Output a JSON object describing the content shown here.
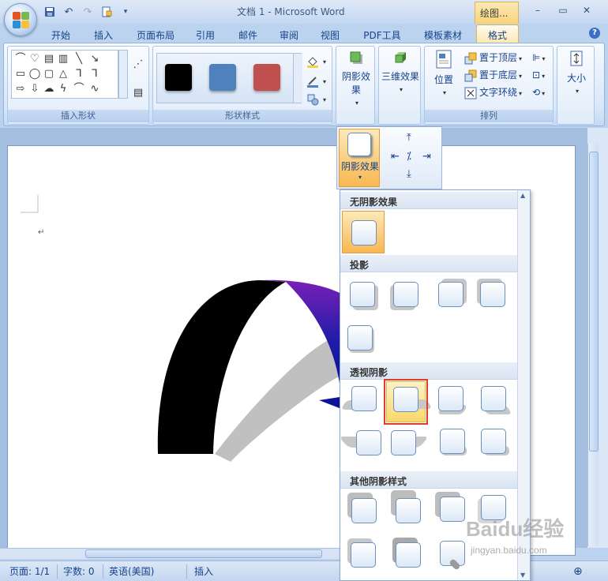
{
  "window": {
    "title": "文档 1 - Microsoft Word",
    "context_tab_header": "绘图...",
    "controls": [
      "–",
      "▭",
      "✕"
    ]
  },
  "quick_access": [
    "save-icon",
    "undo-icon",
    "redo-icon",
    "print-preview-icon"
  ],
  "tabs": [
    {
      "label": "开始"
    },
    {
      "label": "插入"
    },
    {
      "label": "页面布局"
    },
    {
      "label": "引用"
    },
    {
      "label": "邮件"
    },
    {
      "label": "审阅"
    },
    {
      "label": "视图"
    },
    {
      "label": "PDF工具"
    },
    {
      "label": "模板素材"
    },
    {
      "label": "格式",
      "active": true
    }
  ],
  "ribbon": {
    "insert_shapes": {
      "label": "插入形状"
    },
    "shape_styles": {
      "label": "形状样式",
      "swatches": [
        "#000000",
        "#4f81bd",
        "#c0504d"
      ]
    },
    "shadow_effects": {
      "label": "阴影效果"
    },
    "three_d_effects": {
      "label": "三维效果"
    },
    "arrange": {
      "label": "排列",
      "position": "位置",
      "bring_to_front": "置于顶层",
      "send_to_back": "置于底层",
      "text_wrap": "文字环绕"
    },
    "size": {
      "label": "大小"
    }
  },
  "shadow_button": {
    "label": "阴影效果"
  },
  "gallery": {
    "sections": [
      {
        "title": "无阴影效果"
      },
      {
        "title": "投影"
      },
      {
        "title": "透视阴影"
      },
      {
        "title": "其他阴影样式"
      }
    ]
  },
  "statusbar": {
    "page": "页面: 1/1",
    "words": "字数: 0",
    "language": "英语(美国)",
    "mode": "插入"
  },
  "watermark": {
    "text": "Baidu经验",
    "sub": "jingyan.baidu.com"
  }
}
